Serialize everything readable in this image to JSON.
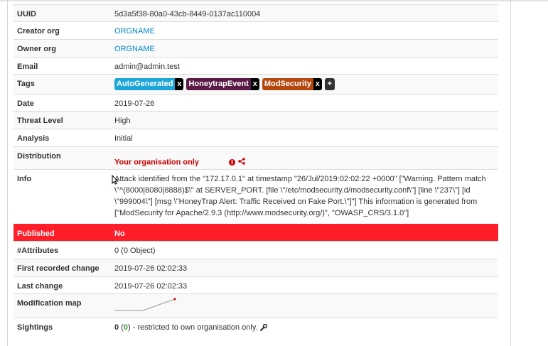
{
  "event": {
    "uuid_label": "UUID",
    "uuid": "5d3a5f38-80a0-43cb-8449-0137ac110004",
    "creator_org_label": "Creator org",
    "creator_org": "ORGNAME",
    "owner_org_label": "Owner org",
    "owner_org": "ORGNAME",
    "email_label": "Email",
    "email": "admin@admin.test",
    "tags_label": "Tags",
    "tags": [
      {
        "name": "AutoGenerated",
        "color": "#1ea6d9"
      },
      {
        "name": "HoneytrapEvent",
        "color": "#5a1a46"
      },
      {
        "name": "ModSecurity",
        "color": "#b5480e"
      }
    ],
    "tag_remove": "x",
    "tag_add": "+",
    "date_label": "Date",
    "date": "2019-07-26",
    "threat_level_label": "Threat Level",
    "threat_level": "High",
    "analysis_label": "Analysis",
    "analysis": "Initial",
    "distribution_label": "Distribution",
    "distribution": "Your organisation only",
    "info_label": "Info",
    "info": "Attack identified from the \"172.17.0.1\" at timestamp \"26/Jul/2019:02:02:22 +0000\" [\"Warning. Pattern match \\\"^(8000|8080|8888)$\\\" at SERVER_PORT. [file \\\"/etc/modsecurity.d/modsecurity.conf\\\"] [line \\\"237\\\"] [id \\\"999004\\\"] [msg \\\"HoneyTrap Alert: Traffic Received on Fake Port.\\\"]\"] This information is generated from [\"ModSecurity for Apache/2.9.3 (http://www.modsecurity.org/)\", \"OWASP_CRS/3.1.0\"]",
    "published_label": "Published",
    "published": "No",
    "attributes_label": "#Attributes",
    "attributes": "0 (0 Object)",
    "first_recorded_label": "First recorded change",
    "first_recorded": "2019-07-26 02:02:33",
    "last_change_label": "Last change",
    "last_change": "2019-07-26 02:02:33",
    "modification_map_label": "Modification map",
    "sightings_label": "Sightings",
    "sightings_count": "0",
    "sightings_own": "0",
    "sightings_text": "- restricted to own organisation only."
  },
  "colors": {
    "published_bg": "#ff1e2a",
    "link": "#0088cc",
    "distribution": "#cc0000"
  }
}
